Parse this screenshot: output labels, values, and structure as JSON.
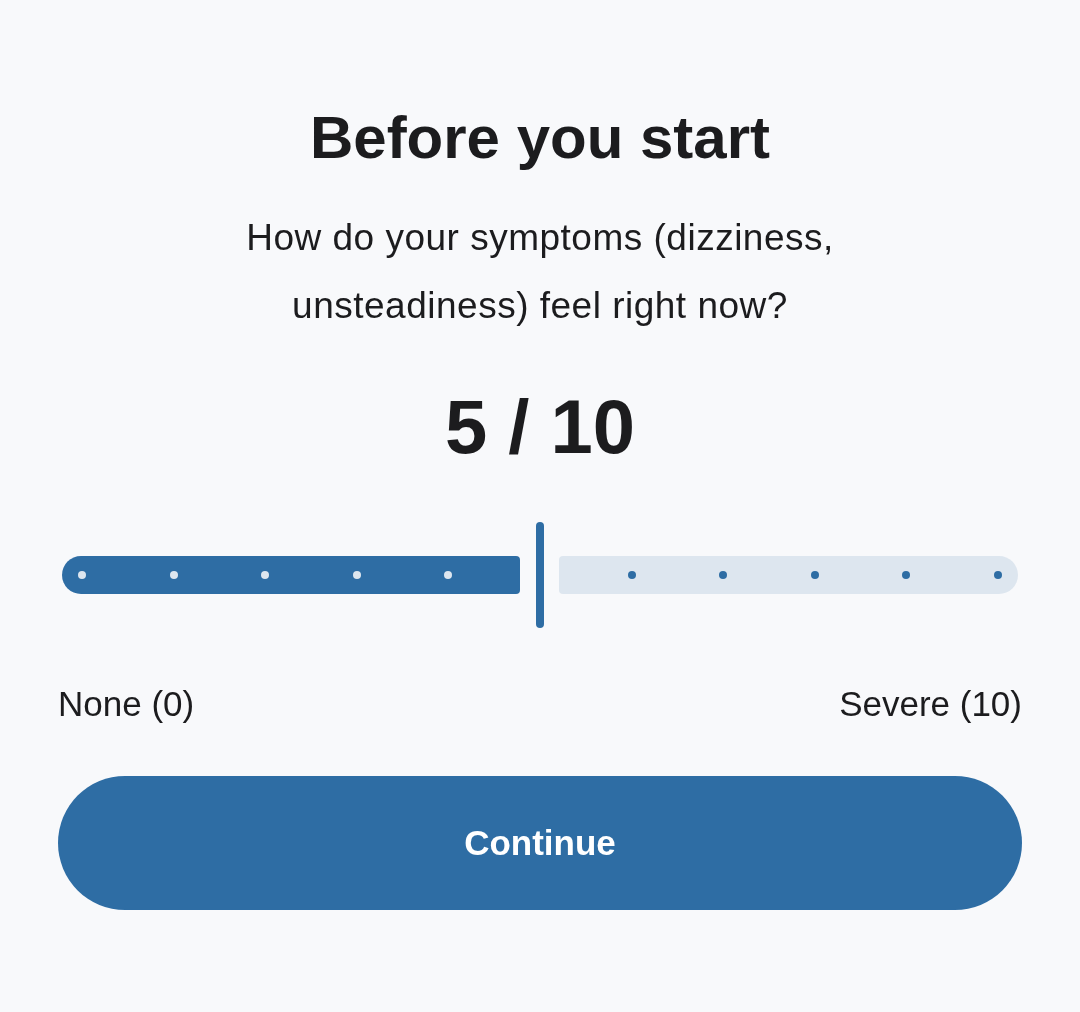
{
  "title": "Before you start",
  "question": "How do your symptoms (dizziness, unsteadiness) feel right now?",
  "reading": "5 / 10",
  "slider": {
    "level": 0.5
  },
  "scale_labels": [
    "None (0)",
    "Severe (10)"
  ],
  "button": {
    "label": "Continue"
  }
}
